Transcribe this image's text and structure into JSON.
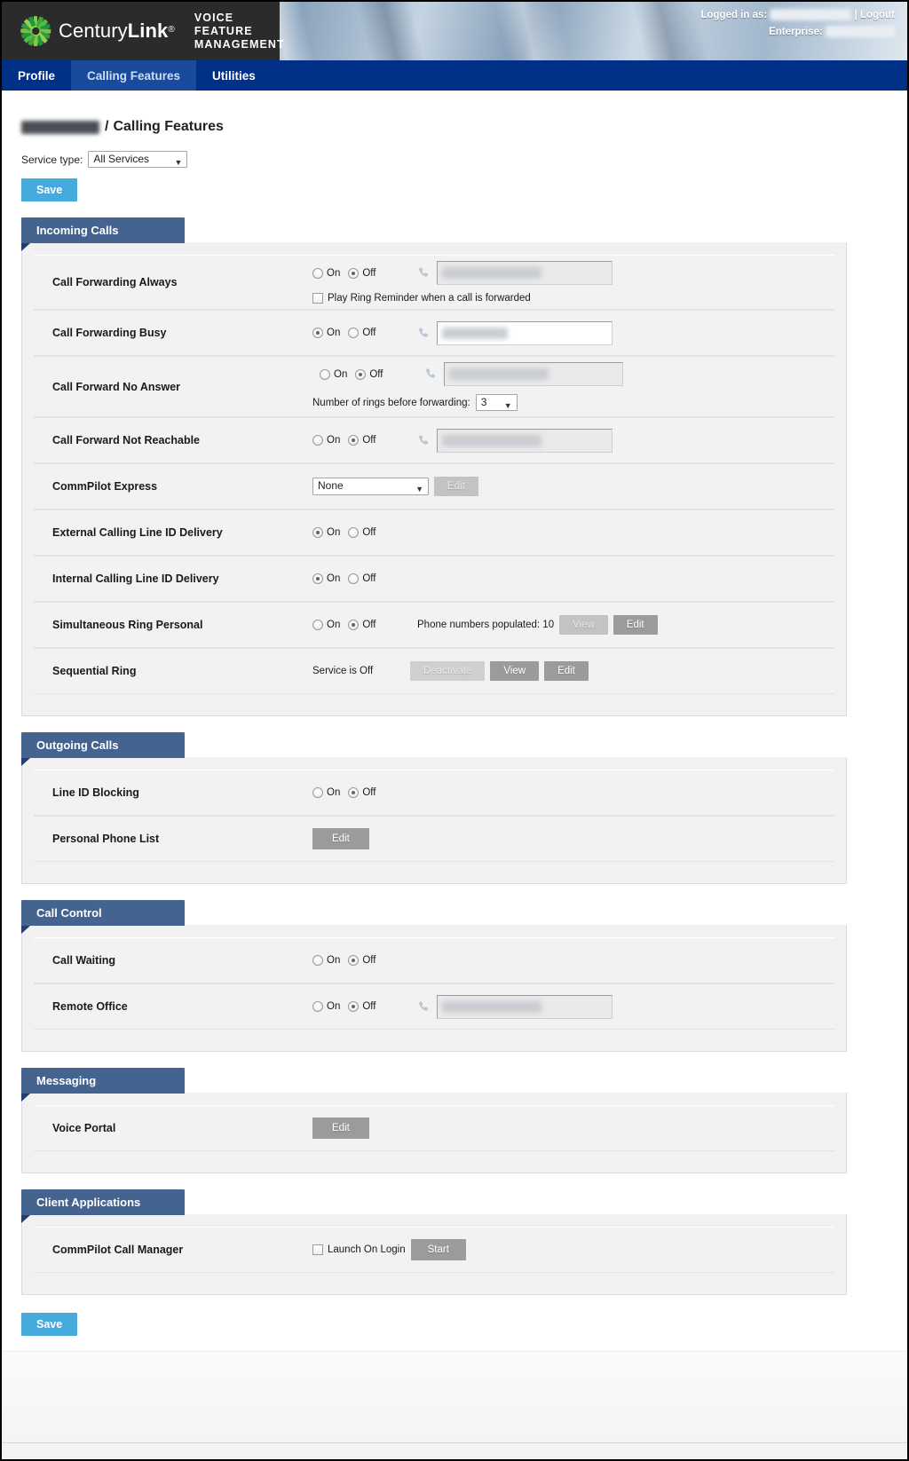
{
  "header": {
    "brand_name_light": "Century",
    "brand_name_bold": "Link",
    "brand_reg": "®",
    "app_title": "VOICE FEATURE\nMANAGEMENT",
    "logged_in_label": "Logged in as:",
    "logged_in_user": "",
    "logout_label": "| Logout",
    "enterprise_label": "Enterprise:",
    "enterprise_value": ""
  },
  "nav": {
    "items": [
      {
        "label": "Profile",
        "active": false
      },
      {
        "label": "Calling Features",
        "active": true
      },
      {
        "label": "Utilities",
        "active": false
      }
    ]
  },
  "breadcrumb": {
    "user": "",
    "separator": "/",
    "page": "Calling Features"
  },
  "service_type": {
    "label": "Service type:",
    "value": "All Services",
    "caret": "▼"
  },
  "buttons": {
    "save_top": "Save",
    "save_bottom": "Save",
    "edit": "Edit",
    "view": "View",
    "start": "Start",
    "deactivate": "Deactivate"
  },
  "radio_labels": {
    "on": "On",
    "off": "Off"
  },
  "sections": [
    {
      "title": "Incoming Calls",
      "rows": [
        {
          "label": "Call Forwarding Always",
          "type": "radio-phone-check",
          "state": "off",
          "phone_value": "",
          "phone_enabled": false,
          "checkbox_label": "Play Ring Reminder when a call is forwarded",
          "checkbox_checked": false
        },
        {
          "label": "Call Forwarding Busy",
          "type": "radio-phone",
          "state": "on",
          "phone_value": "",
          "phone_enabled": true
        },
        {
          "label": "Call Forward No Answer",
          "type": "radio-phone-rings",
          "state": "off",
          "phone_value": "",
          "phone_enabled": false,
          "rings_label": "Number of rings before forwarding:",
          "rings_value": "3"
        },
        {
          "label": "Call Forward Not Reachable",
          "type": "radio-phone",
          "state": "off",
          "phone_value": "",
          "phone_enabled": false
        },
        {
          "label": "CommPilot Express",
          "type": "select-edit",
          "select_value": "None",
          "edit_label": "Edit"
        },
        {
          "label": "External Calling Line ID Delivery",
          "type": "radio",
          "state": "on"
        },
        {
          "label": "Internal Calling Line ID Delivery",
          "type": "radio",
          "state": "on"
        },
        {
          "label": "Simultaneous Ring Personal",
          "type": "radio-populated",
          "state": "off",
          "populated_text": "Phone numbers populated: 10",
          "view_label": "View",
          "edit_label": "Edit"
        },
        {
          "label": "Sequential Ring",
          "type": "status-buttons",
          "status_text": "Service is Off",
          "deactivate_label": "Deactivate",
          "view_label": "View",
          "edit_label": "Edit"
        }
      ]
    },
    {
      "title": "Outgoing Calls",
      "rows": [
        {
          "label": "Line ID Blocking",
          "type": "radio",
          "state": "off"
        },
        {
          "label": "Personal Phone List",
          "type": "edit-only",
          "edit_label": "Edit"
        }
      ]
    },
    {
      "title": "Call Control",
      "rows": [
        {
          "label": "Call Waiting",
          "type": "radio",
          "state": "off"
        },
        {
          "label": "Remote Office",
          "type": "radio-phone",
          "state": "off",
          "phone_value": "",
          "phone_enabled": false
        }
      ]
    },
    {
      "title": "Messaging",
      "rows": [
        {
          "label": "Voice Portal",
          "type": "edit-only",
          "edit_label": "Edit"
        }
      ]
    },
    {
      "title": "Client Applications",
      "rows": [
        {
          "label": "CommPilot Call Manager",
          "type": "check-start",
          "checkbox_label": "Launch On Login",
          "checkbox_checked": false,
          "start_label": "Start"
        }
      ]
    }
  ],
  "colors": {
    "brand_dark": "#2b2b2b",
    "nav_blue": "#003087",
    "nav_active": "#1a4a9c",
    "section_tab": "#44648f",
    "section_fold": "#22406b",
    "save_blue": "#46aadc",
    "gray_button": "#9b9b9b",
    "logo_green": "#6cbe45",
    "logo_green_dark": "#1a8b3c"
  }
}
